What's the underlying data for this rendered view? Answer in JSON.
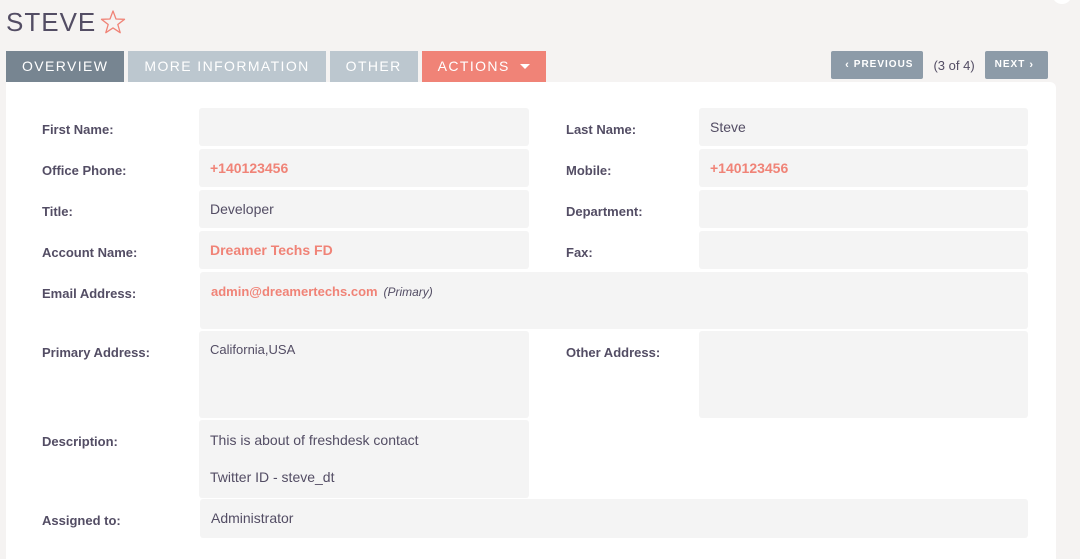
{
  "record": {
    "title": "STEVE"
  },
  "icons": {
    "favorite": "star-outline-icon",
    "prev": "chevron-left-icon",
    "next": "chevron-right-icon",
    "actions_menu": "caret-down-icon"
  },
  "colors": {
    "accent": "#f08377",
    "tab_active": "#778591",
    "tab_inactive": "#bcc7cf",
    "pager_button": "#8d9ba8",
    "field_bg": "#f4f4f4",
    "text": "#534d64"
  },
  "tabs": [
    {
      "label": "OVERVIEW",
      "active": true
    },
    {
      "label": "MORE INFORMATION",
      "active": false
    },
    {
      "label": "OTHER",
      "active": false
    },
    {
      "label": "ACTIONS",
      "active": false
    }
  ],
  "pager": {
    "prev_label": "PREVIOUS",
    "count": "(3 of 4)",
    "next_label": "NEXT"
  },
  "fields": {
    "first_name": {
      "label": "First Name:",
      "value": ""
    },
    "last_name": {
      "label": "Last Name:",
      "value": "Steve"
    },
    "office_phone": {
      "label": "Office Phone:",
      "value": "+140123456"
    },
    "mobile": {
      "label": "Mobile:",
      "value": "+140123456"
    },
    "title": {
      "label": "Title:",
      "value": "Developer"
    },
    "department": {
      "label": "Department:",
      "value": ""
    },
    "account_name": {
      "label": "Account Name:",
      "value": "Dreamer Techs FD"
    },
    "fax": {
      "label": "Fax:",
      "value": ""
    },
    "email": {
      "label": "Email Address:",
      "value": "admin@dreamertechs.com",
      "note": "(Primary)"
    },
    "primary_address": {
      "label": "Primary Address:",
      "value": "California,USA"
    },
    "other_address": {
      "label": "Other Address:",
      "value": ""
    },
    "description": {
      "label": "Description:",
      "lines": [
        "This is about of freshdesk contact",
        "Twitter ID - steve_dt"
      ]
    },
    "assigned_to": {
      "label": "Assigned to:",
      "value": "Administrator"
    }
  }
}
